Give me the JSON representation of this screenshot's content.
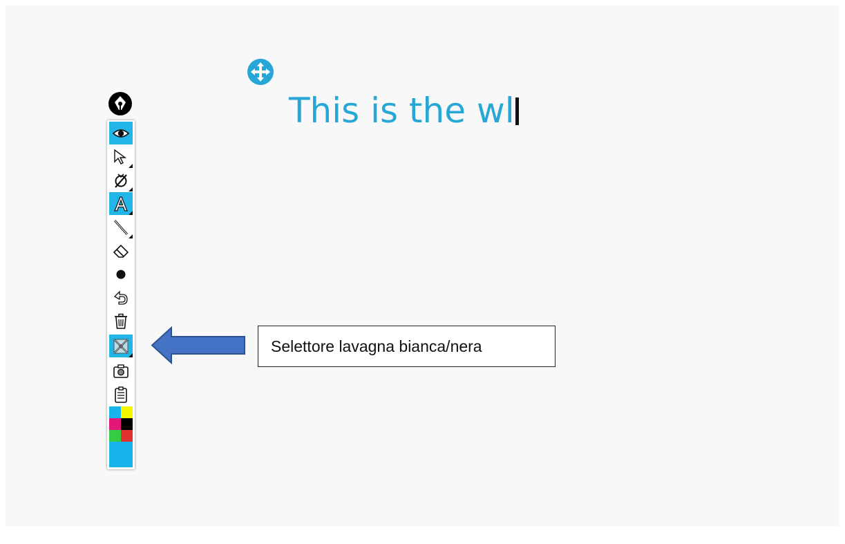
{
  "whiteboard": {
    "text": "This is the wl",
    "text_color": "#27a7d6"
  },
  "toolbar": {
    "tools": [
      {
        "name": "eye-icon",
        "active": true,
        "has_submenu": false
      },
      {
        "name": "select-arrow-icon",
        "active": false,
        "has_submenu": true
      },
      {
        "name": "hide-pen-icon",
        "active": false,
        "has_submenu": true
      },
      {
        "name": "text-tool-icon",
        "active": true,
        "has_submenu": true
      },
      {
        "name": "line-tool-icon",
        "active": false,
        "has_submenu": true
      },
      {
        "name": "eraser-icon",
        "active": false,
        "has_submenu": false
      },
      {
        "name": "dot-size-icon",
        "active": false,
        "has_submenu": false
      },
      {
        "name": "undo-icon",
        "active": false,
        "has_submenu": false
      },
      {
        "name": "trash-icon",
        "active": false,
        "has_submenu": false
      },
      {
        "name": "board-selector-icon",
        "active": true,
        "has_submenu": true
      },
      {
        "name": "camera-icon",
        "active": false,
        "has_submenu": false
      },
      {
        "name": "clipboard-icon",
        "active": false,
        "has_submenu": false
      }
    ],
    "palette": [
      "#19b4ec",
      "#f6f600",
      "#e3167a",
      "#000000",
      "#33cc44",
      "#e03030"
    ],
    "selected_color": "#19b4ec"
  },
  "callout": {
    "label": "Selettore lavagna bianca/nera",
    "arrow_color": "#4472c4"
  }
}
